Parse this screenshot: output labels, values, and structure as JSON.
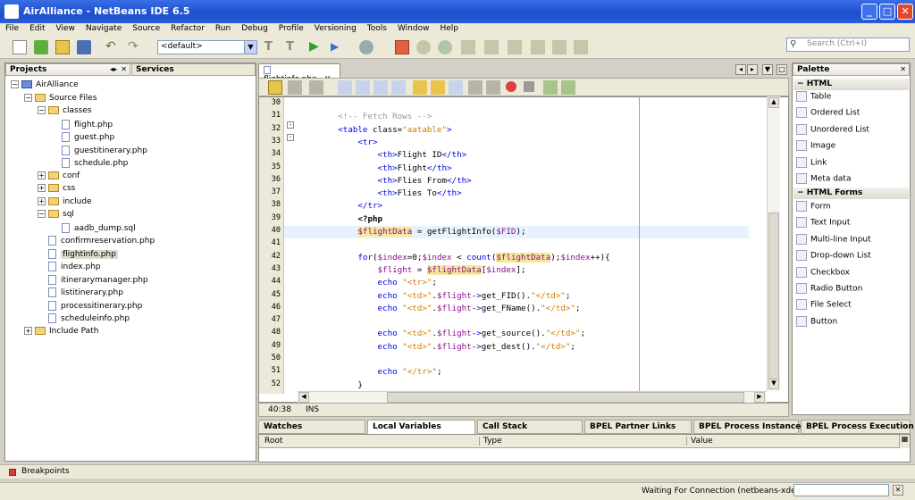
{
  "window": {
    "title": "AirAlliance - NetBeans IDE 6.5"
  },
  "menu": [
    "File",
    "Edit",
    "View",
    "Navigate",
    "Source",
    "Refactor",
    "Run",
    "Debug",
    "Profile",
    "Versioning",
    "Tools",
    "Window",
    "Help"
  ],
  "toolbar": {
    "config": "<default>"
  },
  "search": {
    "placeholder": "Search (Ctrl+I)"
  },
  "panels": {
    "projects": "Projects",
    "services": "Services",
    "palette": "Palette"
  },
  "project_tree": [
    {
      "label": "AirAlliance",
      "kind": "project",
      "depth": 0,
      "expanded": true
    },
    {
      "label": "Source Files",
      "kind": "folder",
      "depth": 1,
      "expanded": true
    },
    {
      "label": "classes",
      "kind": "folder",
      "depth": 2,
      "expanded": true
    },
    {
      "label": "flight.php",
      "kind": "file",
      "depth": 3
    },
    {
      "label": "guest.php",
      "kind": "file",
      "depth": 3
    },
    {
      "label": "guestitinerary.php",
      "kind": "file",
      "depth": 3
    },
    {
      "label": "schedule.php",
      "kind": "file",
      "depth": 3
    },
    {
      "label": "conf",
      "kind": "folder",
      "depth": 2,
      "expanded": false
    },
    {
      "label": "css",
      "kind": "folder",
      "depth": 2,
      "expanded": false
    },
    {
      "label": "include",
      "kind": "folder",
      "depth": 2,
      "expanded": false
    },
    {
      "label": "sql",
      "kind": "folder",
      "depth": 2,
      "expanded": true
    },
    {
      "label": "aadb_dump.sql",
      "kind": "file",
      "depth": 3
    },
    {
      "label": "confirmreservation.php",
      "kind": "file",
      "depth": 2
    },
    {
      "label": "flightinfo.php",
      "kind": "file",
      "depth": 2,
      "selected": true
    },
    {
      "label": "index.php",
      "kind": "file",
      "depth": 2
    },
    {
      "label": "itinerarymanager.php",
      "kind": "file",
      "depth": 2
    },
    {
      "label": "listitinerary.php",
      "kind": "file",
      "depth": 2
    },
    {
      "label": "processitinerary.php",
      "kind": "file",
      "depth": 2
    },
    {
      "label": "scheduleinfo.php",
      "kind": "file",
      "depth": 2
    },
    {
      "label": "Include Path",
      "kind": "folder",
      "depth": 1,
      "expanded": false
    }
  ],
  "editor": {
    "tab": "flightinfo.php",
    "cursor": "40:38",
    "mode": "INS",
    "lines": [
      {
        "n": "30",
        "text": ""
      },
      {
        "n": "31",
        "text": "        <!-- Fetch Rows -->"
      },
      {
        "n": "32",
        "text": "        <table class=\"aatable\">"
      },
      {
        "n": "33",
        "text": "            <tr>"
      },
      {
        "n": "34",
        "text": "                <th>Flight ID</th>"
      },
      {
        "n": "35",
        "text": "                <th>Flight</th>"
      },
      {
        "n": "36",
        "text": "                <th>Flies From</th>"
      },
      {
        "n": "37",
        "text": "                <th>Flies To</th>"
      },
      {
        "n": "38",
        "text": "            </tr>"
      },
      {
        "n": "39",
        "text": "            <?php"
      },
      {
        "n": "40",
        "text": "            $flightData = getFlightInfo($FID);"
      },
      {
        "n": "41",
        "text": ""
      },
      {
        "n": "42",
        "text": "            for($index=0;$index < count($flightData);$index++){"
      },
      {
        "n": "43",
        "text": "                $flight = $flightData[$index];"
      },
      {
        "n": "44",
        "text": "                echo \"<tr>\";"
      },
      {
        "n": "45",
        "text": "                echo \"<td>\".$flight->get_FID().\"</td>\";"
      },
      {
        "n": "46",
        "text": "                echo \"<td>\".$flight->get_FName().\"</td>\";"
      },
      {
        "n": "47",
        "text": ""
      },
      {
        "n": "48",
        "text": "                echo \"<td>\".$flight->get_source().\"</td>\";"
      },
      {
        "n": "49",
        "text": "                echo \"<td>\".$flight->get_dest().\"</td>\";"
      },
      {
        "n": "50",
        "text": ""
      },
      {
        "n": "51",
        "text": "                echo \"</tr>\";"
      },
      {
        "n": "52",
        "text": "            }"
      }
    ]
  },
  "palette": {
    "html_category": "HTML",
    "html_items": [
      "Table",
      "Ordered List",
      "Unordered List",
      "Image",
      "Link",
      "Meta data"
    ],
    "forms_category": "HTML Forms",
    "forms_items": [
      "Form",
      "Text Input",
      "Multi-line Input",
      "Drop-down List",
      "Checkbox",
      "Radio Button",
      "File Select",
      "Button"
    ]
  },
  "debug_tabs": [
    "Watches",
    "Local Variables",
    "Call Stack",
    "BPEL Partner Links",
    "BPEL Process Instances",
    "BPEL Process Execution"
  ],
  "debug_columns": [
    "Root",
    "Type",
    "Value"
  ],
  "breakpoints": "Breakpoints",
  "status": "Waiting For Connection (netbeans-xdebug)"
}
